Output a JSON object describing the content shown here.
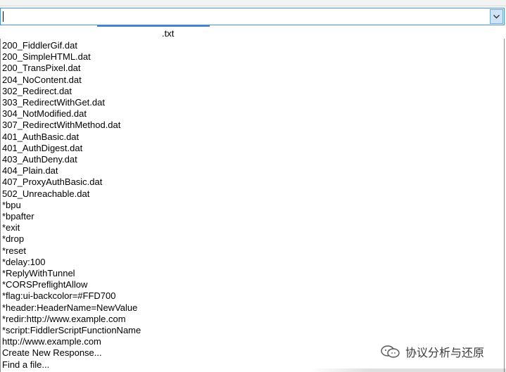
{
  "combo": {
    "value": "",
    "dropdown_icon": "chevron-down-icon"
  },
  "underlay": {
    "partial_text": ".txt"
  },
  "items": [
    "200_FiddlerGif.dat",
    "200_SimpleHTML.dat",
    "200_TransPixel.dat",
    "204_NoContent.dat",
    "302_Redirect.dat",
    "303_RedirectWithGet.dat",
    "304_NotModified.dat",
    "307_RedirectWithMethod.dat",
    "401_AuthBasic.dat",
    "401_AuthDigest.dat",
    "403_AuthDeny.dat",
    "404_Plain.dat",
    "407_ProxyAuthBasic.dat",
    "502_Unreachable.dat",
    "*bpu",
    "*bpafter",
    "*exit",
    "*drop",
    "*reset",
    "*delay:100",
    "*ReplyWithTunnel",
    "*CORSPreflightAllow",
    "*flag:ui-backcolor=#FFD700",
    "*header:HeaderName=NewValue",
    "*redir:http://www.example.com",
    "*script:FiddlerScriptFunctionName",
    "http://www.example.com",
    "Create New Response...",
    "Find a file..."
  ],
  "watermark": {
    "text": "协议分析与还原",
    "icon": "wechat-icon"
  }
}
